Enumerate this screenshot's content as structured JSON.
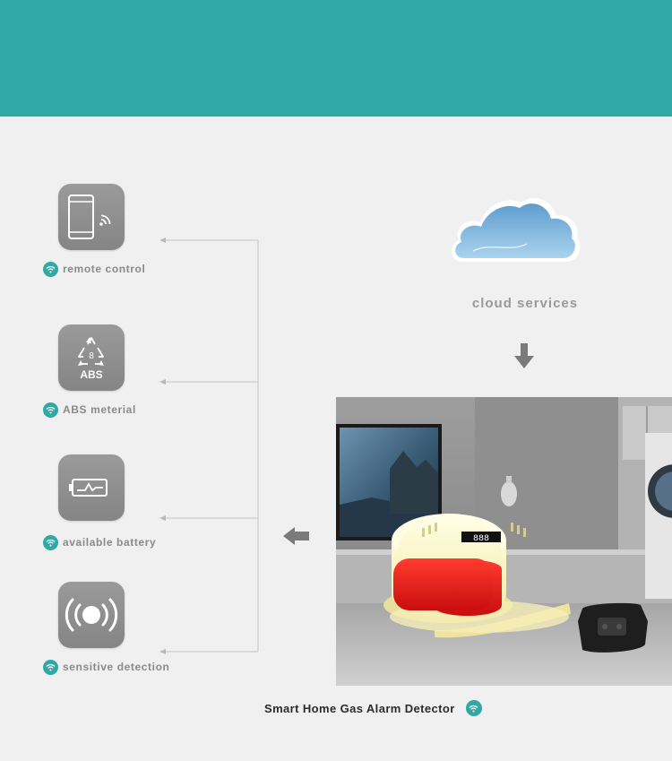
{
  "colors": {
    "banner": "#2fa8a6",
    "tile": "#8f8f8f",
    "label": "#8a8a8a",
    "cloud": "#7fb7dd"
  },
  "features": [
    {
      "label": "remote control",
      "icon": "smartphone-signal-icon"
    },
    {
      "label": "ABS meterial",
      "icon": "abs-recycle-icon",
      "icon_number": "8",
      "icon_text": "ABS"
    },
    {
      "label": "available battery",
      "icon": "battery-icon"
    },
    {
      "label": "sensitive detection",
      "icon": "sound-wave-icon"
    }
  ],
  "cloud": {
    "label": "cloud services",
    "icon": "cloud-icon"
  },
  "product": {
    "caption": "Smart Home Gas Alarm Detector",
    "display": "888"
  }
}
